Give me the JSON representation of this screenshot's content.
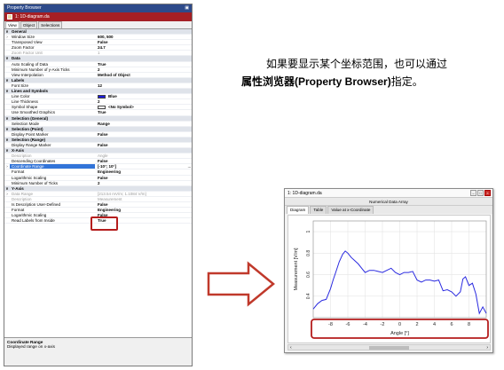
{
  "property_browser": {
    "title": "Property Browser",
    "pin_icon": "pin-icon",
    "document": "1: 1D-diagram.da",
    "tabs": [
      "View",
      "Object",
      "Selections"
    ],
    "rows": [
      {
        "kind": "cat",
        "exp": "∨",
        "name": "General"
      },
      {
        "kind": "prop",
        "exp": "›",
        "name": "Window Size",
        "value": "600, 500"
      },
      {
        "kind": "prop",
        "name": "Transposed View",
        "value": "False"
      },
      {
        "kind": "prop",
        "name": "Zoom Factor",
        "value": "24.7"
      },
      {
        "kind": "dis",
        "name": "Zoom Factor Unit",
        "value": "1"
      },
      {
        "kind": "cat",
        "exp": "∨",
        "name": "Data"
      },
      {
        "kind": "prop",
        "name": "Auto Scaling of Data",
        "value": "True"
      },
      {
        "kind": "prop",
        "name": "Minimum Number of y-Axis Ticks",
        "value": "2"
      },
      {
        "kind": "prop",
        "name": "View Interpolation",
        "value": "Method of Object"
      },
      {
        "kind": "cat",
        "exp": "∨",
        "name": "Labels"
      },
      {
        "kind": "prop",
        "name": "Font Size",
        "value": "12"
      },
      {
        "kind": "cat",
        "exp": "∨",
        "name": "Lines and Symbols"
      },
      {
        "kind": "prop",
        "name": "Line Color",
        "value": "Blue",
        "swatch": "#1a1adc"
      },
      {
        "kind": "prop",
        "name": "Line Thickness",
        "value": "2"
      },
      {
        "kind": "prop",
        "name": "Symbol Shape",
        "value": "<No Symbol>",
        "swatch": "#ffffff"
      },
      {
        "kind": "prop",
        "name": "Use Smoothed Graphics",
        "value": "True"
      },
      {
        "kind": "cat",
        "exp": "∨",
        "name": "Selection (General)"
      },
      {
        "kind": "prop",
        "name": "Selection Mode",
        "value": "Range"
      },
      {
        "kind": "cat",
        "exp": "∨",
        "name": "Selection (Point)"
      },
      {
        "kind": "prop",
        "name": "Display Point Marker",
        "value": "False"
      },
      {
        "kind": "cat",
        "exp": "∨",
        "name": "Selection (Range)"
      },
      {
        "kind": "prop",
        "name": "Display Range Marker",
        "value": "False"
      },
      {
        "kind": "cat",
        "exp": "∨",
        "name": "X-Axis"
      },
      {
        "kind": "dis",
        "name": "Description",
        "value": "Angle"
      },
      {
        "kind": "prop",
        "name": "Descending Coordinates",
        "value": "False"
      },
      {
        "kind": "sel",
        "exp": "›",
        "name": "Coordinate Range",
        "value": "[-10°; 10°]",
        "ellipsis": "..."
      },
      {
        "kind": "prop",
        "name": "Format",
        "value": "Engineering"
      },
      {
        "kind": "prop",
        "name": "Logarithmic Scaling",
        "value": "False"
      },
      {
        "kind": "prop",
        "name": "Minimum Number of Ticks",
        "value": "2"
      },
      {
        "kind": "cat",
        "exp": "∨",
        "name": "Y-Axis"
      },
      {
        "kind": "dis",
        "exp": "›",
        "name": "Data Range",
        "value": "[213.54 mV/m; 1.1084 V/m]"
      },
      {
        "kind": "dis",
        "name": "Description",
        "value": "Measurement"
      },
      {
        "kind": "prop",
        "name": "Is Description User-Defined",
        "value": "False"
      },
      {
        "kind": "prop",
        "name": "Format",
        "value": "Engineering"
      },
      {
        "kind": "prop",
        "name": "Logarithmic Scaling",
        "value": "False"
      },
      {
        "kind": "prop",
        "name": "Read Labels from Inside",
        "value": "True"
      }
    ],
    "description": {
      "title": "Coordinate Range",
      "text": "Displayed range on x-axis"
    }
  },
  "caption": {
    "line1": "如果要显示某个坐标范围，也可以通过",
    "line2_bold": "属性浏览器(Property Browser)",
    "line2_rest": "指定。"
  },
  "colors": {
    "highlight": "#b51d1d",
    "arrow": "#c0392b",
    "line": "#2a2ae0"
  },
  "diagram_window": {
    "title": "1: 1D-diagram.da",
    "subtitle": "Numerical Data Array",
    "tabs": [
      "Diagram",
      "Table",
      "Value at x-Coordinate"
    ],
    "scroll_left": "‹",
    "scroll_right": "›"
  },
  "chart_data": {
    "type": "line",
    "title": "",
    "xlabel": "Angle [°]",
    "ylabel": "Measurement [V/m]",
    "xlim": [
      -10,
      10
    ],
    "ylim": [
      0.2,
      1.1
    ],
    "xticks": [
      -8,
      -6,
      -4,
      -2,
      0,
      2,
      4,
      6,
      8
    ],
    "yticks": [
      0.4,
      0.6,
      0.8,
      1
    ],
    "series": [
      {
        "x": [
          -10,
          -9.5,
          -9,
          -8.5,
          -8,
          -7.7,
          -7.4,
          -7,
          -6.6,
          -6.3,
          -6,
          -5.6,
          -5.2,
          -4.8,
          -4.4,
          -4,
          -3.5,
          -3,
          -2.5,
          -2,
          -1.5,
          -1,
          -0.5,
          0,
          0.5,
          1,
          1.5,
          2,
          2.5,
          3,
          3.5,
          4,
          4.5,
          5,
          5.5,
          6,
          6.5,
          7,
          7.3,
          7.6,
          8,
          8.4,
          8.8,
          9.2,
          9.6,
          10
        ],
        "y": [
          0.28,
          0.33,
          0.36,
          0.37,
          0.47,
          0.55,
          0.62,
          0.72,
          0.79,
          0.82,
          0.8,
          0.76,
          0.73,
          0.7,
          0.66,
          0.62,
          0.64,
          0.64,
          0.63,
          0.62,
          0.64,
          0.66,
          0.62,
          0.6,
          0.62,
          0.62,
          0.63,
          0.55,
          0.53,
          0.55,
          0.55,
          0.54,
          0.55,
          0.45,
          0.46,
          0.44,
          0.4,
          0.44,
          0.56,
          0.58,
          0.5,
          0.52,
          0.42,
          0.24,
          0.3,
          0.24
        ]
      }
    ]
  }
}
